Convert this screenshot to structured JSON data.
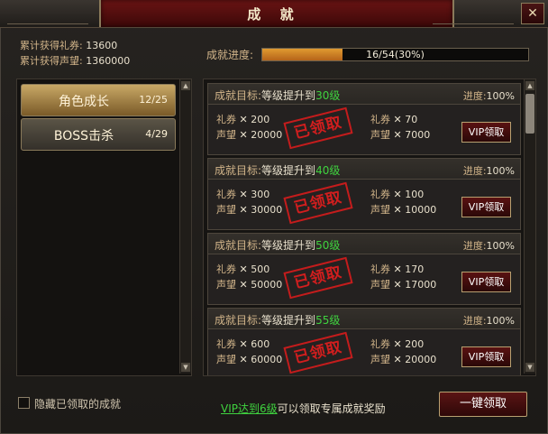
{
  "window": {
    "title": "成 就",
    "close": "✕"
  },
  "stats": {
    "gift_label": "累计获得礼券:",
    "gift_value": "13600",
    "prestige_label": "累计获得声望:",
    "prestige_value": "1360000"
  },
  "progress": {
    "label": "成就进度:",
    "text": "16/54(30%)",
    "fraction": 0.3
  },
  "categories": [
    {
      "name": "角色成长",
      "count": "12/25",
      "selected": true
    },
    {
      "name": "BOSS击杀",
      "count": "4/29",
      "selected": false
    }
  ],
  "cards": [
    {
      "goal_label": "成就目标:",
      "goal_text": "等级提升到",
      "level": "30级",
      "progress_label": "进度:",
      "progress": "100%",
      "gift_label": "礼券",
      "gift": "200",
      "prestige_label": "声望",
      "prestige": "20000",
      "vip_gift": "70",
      "vip_prestige": "7000",
      "stamp": "已领取",
      "button": "VIP领取",
      "times": "✕"
    },
    {
      "goal_label": "成就目标:",
      "goal_text": "等级提升到",
      "level": "40级",
      "progress_label": "进度:",
      "progress": "100%",
      "gift_label": "礼券",
      "gift": "300",
      "prestige_label": "声望",
      "prestige": "30000",
      "vip_gift": "100",
      "vip_prestige": "10000",
      "stamp": "已领取",
      "button": "VIP领取",
      "times": "✕"
    },
    {
      "goal_label": "成就目标:",
      "goal_text": "等级提升到",
      "level": "50级",
      "progress_label": "进度:",
      "progress": "100%",
      "gift_label": "礼券",
      "gift": "500",
      "prestige_label": "声望",
      "prestige": "50000",
      "vip_gift": "170",
      "vip_prestige": "17000",
      "stamp": "已领取",
      "button": "VIP领取",
      "times": "✕"
    },
    {
      "goal_label": "成就目标:",
      "goal_text": "等级提升到",
      "level": "55级",
      "progress_label": "进度:",
      "progress": "100%",
      "gift_label": "礼券",
      "gift": "600",
      "prestige_label": "声望",
      "prestige": "60000",
      "vip_gift": "200",
      "vip_prestige": "20000",
      "stamp": "已领取",
      "button": "VIP领取",
      "times": "✕"
    }
  ],
  "footer": {
    "hide_label": "隐藏已领取的成就",
    "vip_link": "VIP达到6级",
    "vip_text": "可以领取专属成就奖励",
    "claim_all": "一键领取"
  },
  "colors": {
    "accent_green": "#3fd23f",
    "stamp_red": "#e01e1e",
    "label_gold": "#d2b58a",
    "progress_orange": "#e09a30"
  }
}
